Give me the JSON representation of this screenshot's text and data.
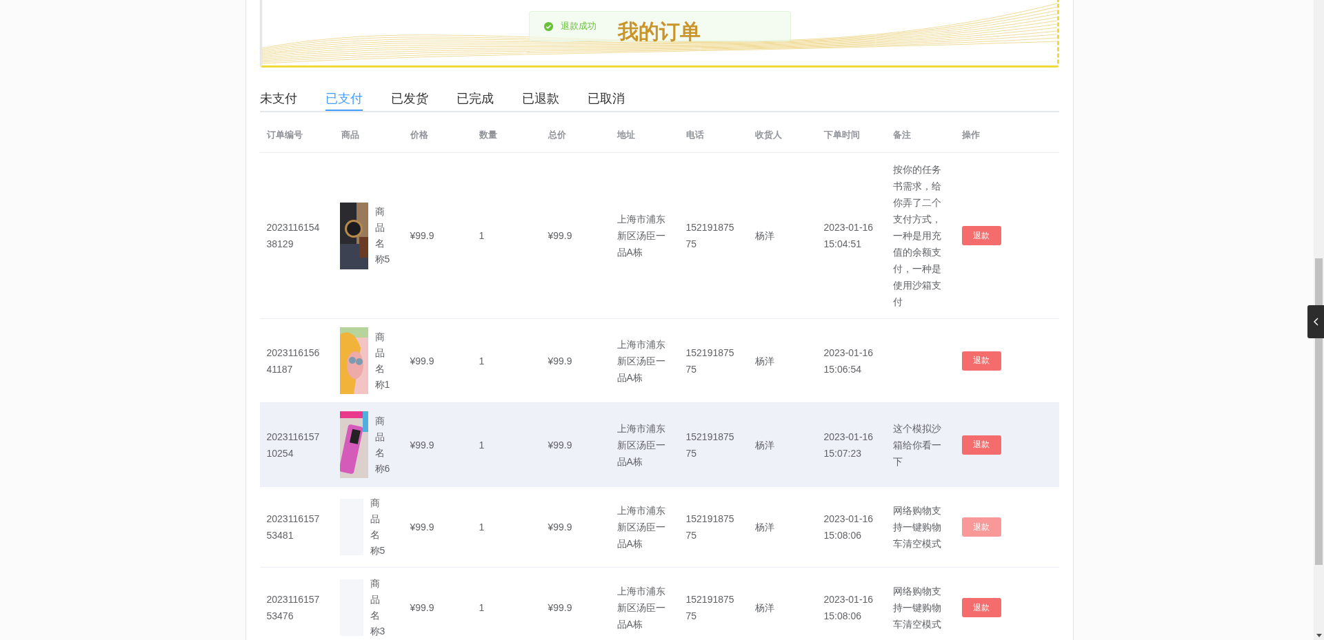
{
  "banner": {
    "title": "我的订单"
  },
  "toast": {
    "kind": "success",
    "message": "退款成功"
  },
  "tabs": [
    {
      "label": "未支付",
      "selected": false
    },
    {
      "label": "已支付",
      "selected": true
    },
    {
      "label": "已发货",
      "selected": false
    },
    {
      "label": "已完成",
      "selected": false
    },
    {
      "label": "已退款",
      "selected": false
    },
    {
      "label": "已取消",
      "selected": false
    }
  ],
  "table": {
    "columns": [
      "订单编号",
      "商品",
      "价格",
      "数量",
      "总价",
      "地址",
      "电话",
      "收货人",
      "下单时间",
      "备注",
      "操作"
    ],
    "rows": [
      {
        "order_no": "202311615438129",
        "product": "商品名称5",
        "price": "¥99.9",
        "quantity": "1",
        "total": "¥99.9",
        "address": "上海市浦东新区汤臣一品A栋",
        "phone": "15219187575",
        "receiver": "杨洋",
        "order_time": "2023-01-16 15:04:51",
        "note": "按你的任务书需求，给你弄了二个支付方式，一种是用充值的余额支付，一种是使用沙箱支付",
        "action": {
          "label": "退款",
          "hovered": false
        },
        "highlighted": false
      },
      {
        "order_no": "202311615641187",
        "product": "商品名称1",
        "price": "¥99.9",
        "quantity": "1",
        "total": "¥99.9",
        "address": "上海市浦东新区汤臣一品A栋",
        "phone": "15219187575",
        "receiver": "杨洋",
        "order_time": "2023-01-16 15:06:54",
        "action": {
          "label": "退款",
          "hovered": false
        },
        "highlighted": false
      },
      {
        "order_no": "202311615710254",
        "product": "商品名称6",
        "price": "¥99.9",
        "quantity": "1",
        "total": "¥99.9",
        "address": "上海市浦东新区汤臣一品A栋",
        "phone": "15219187575",
        "receiver": "杨洋",
        "order_time": "2023-01-16 15:07:23",
        "note": "这个模拟沙箱给你看一下",
        "action": {
          "label": "退款",
          "hovered": false
        },
        "highlighted": true
      },
      {
        "order_no": "202311615753481",
        "image": {
          "kind": "empty"
        },
        "product": "商品名称5",
        "price": "¥99.9",
        "quantity": "1",
        "total": "¥99.9",
        "address": "上海市浦东新区汤臣一品A栋",
        "phone": "15219187575",
        "receiver": "杨洋",
        "order_time": "2023-01-16 15:08:06",
        "note": "网络购物支持一键购物车清空模式",
        "action": {
          "label": "退款",
          "hovered": true
        },
        "highlighted": false
      },
      {
        "order_no": "202311615753476",
        "image": {
          "kind": "empty"
        },
        "product": "商品名称3",
        "price": "¥99.9",
        "quantity": "1",
        "total": "¥99.9",
        "address": "上海市浦东新区汤臣一品A栋",
        "phone": "15219187575",
        "receiver": "杨洋",
        "order_time": "2023-01-16 15:08:06",
        "note": "网络购物支持一键购物车清空模式",
        "action": {
          "label": "退款",
          "hovered": false
        },
        "highlighted": false
      }
    ]
  }
}
